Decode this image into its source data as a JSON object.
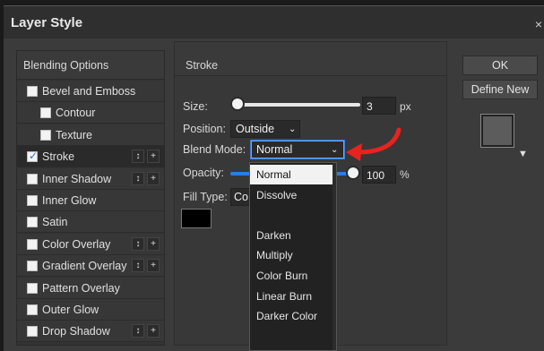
{
  "window": {
    "title": "Layer Style",
    "close_glyph": "×"
  },
  "styles_panel": {
    "header": "Blending Options",
    "items": [
      {
        "label": "Bevel and Emboss",
        "checked": false,
        "indent": false,
        "controls": false
      },
      {
        "label": "Contour",
        "checked": false,
        "indent": true,
        "controls": false
      },
      {
        "label": "Texture",
        "checked": false,
        "indent": true,
        "controls": false
      },
      {
        "label": "Stroke",
        "checked": true,
        "indent": false,
        "controls": true,
        "active": true
      },
      {
        "label": "Inner Shadow",
        "checked": false,
        "indent": false,
        "controls": true
      },
      {
        "label": "Inner Glow",
        "checked": false,
        "indent": false,
        "controls": false
      },
      {
        "label": "Satin",
        "checked": false,
        "indent": false,
        "controls": false
      },
      {
        "label": "Color Overlay",
        "checked": false,
        "indent": false,
        "controls": true
      },
      {
        "label": "Gradient Overlay",
        "checked": false,
        "indent": false,
        "controls": true
      },
      {
        "label": "Pattern Overlay",
        "checked": false,
        "indent": false,
        "controls": false
      },
      {
        "label": "Outer Glow",
        "checked": false,
        "indent": false,
        "controls": false
      },
      {
        "label": "Drop Shadow",
        "checked": false,
        "indent": false,
        "controls": true
      }
    ],
    "move_glyph": "↕",
    "add_glyph": "+"
  },
  "stroke": {
    "header": "Stroke",
    "size_label": "Size:",
    "size_value": "3",
    "size_unit": "px",
    "position_label": "Position:",
    "position_value": "Outside",
    "blend_mode_label": "Blend Mode:",
    "blend_mode_value": "Normal",
    "opacity_label": "Opacity:",
    "opacity_value": "100",
    "opacity_unit": "%",
    "fill_type_label": "Fill Type:",
    "fill_type_value": "Co",
    "stroke_color": "#000000"
  },
  "blend_dropdown": {
    "options": [
      "Normal",
      "Dissolve",
      "",
      "Darken",
      "Multiply",
      "Color Burn",
      "Linear Burn",
      "Darker Color"
    ],
    "selected": "Normal"
  },
  "buttons": {
    "ok": "OK",
    "define_new": "Define New"
  },
  "colors": {
    "accent": "#2f7de1",
    "annotation_arrow": "#e8231f",
    "panel": "#383838"
  }
}
